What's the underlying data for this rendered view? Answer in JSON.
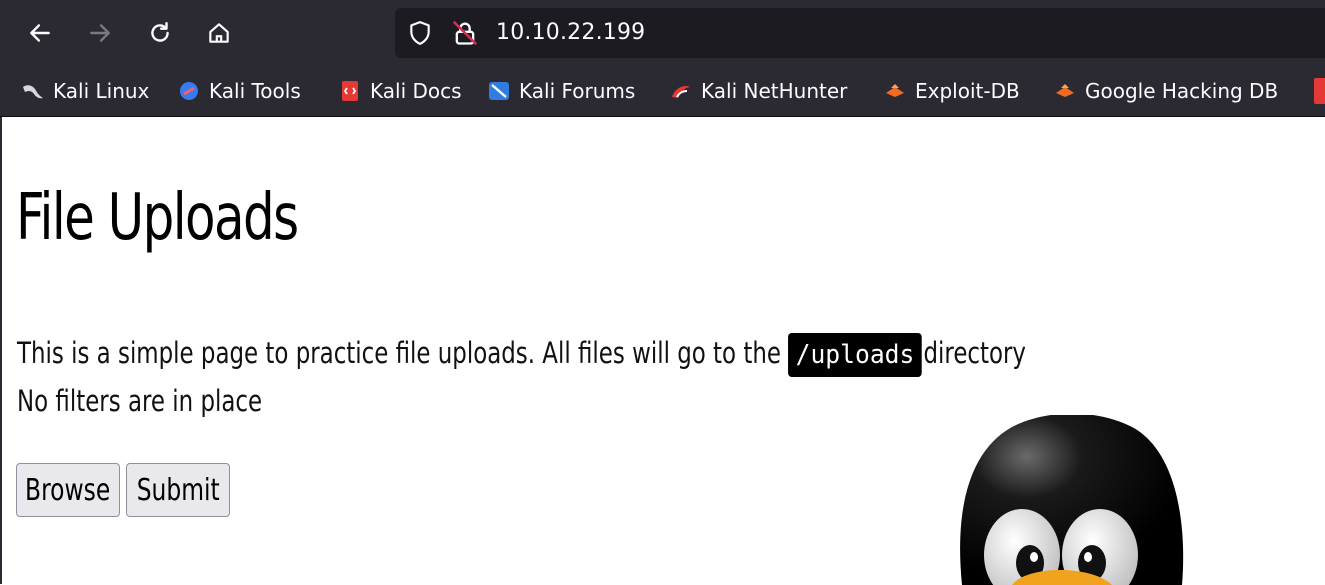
{
  "browser": {
    "nav": {
      "back_icon": "arrow-left-icon",
      "forward_icon": "arrow-right-icon",
      "reload_icon": "reload-icon",
      "home_icon": "home-icon"
    },
    "address_bar": {
      "url": "10.10.22.199",
      "shield_icon": "shield-icon",
      "insecure_lock_icon": "insecure-lock-icon"
    },
    "bookmarks": [
      {
        "label": "Kali Linux",
        "icon": "kali-dragon-icon"
      },
      {
        "label": "Kali Tools",
        "icon": "kali-tools-icon"
      },
      {
        "label": "Kali Docs",
        "icon": "kali-docs-icon"
      },
      {
        "label": "Kali Forums",
        "icon": "kali-forums-icon"
      },
      {
        "label": "Kali NetHunter",
        "icon": "kali-nethunter-icon"
      },
      {
        "label": "Exploit-DB",
        "icon": "exploit-db-icon"
      },
      {
        "label": "Google Hacking DB",
        "icon": "ghdb-icon"
      }
    ]
  },
  "page": {
    "title": "File Uploads",
    "description_before": "This is a simple page to practice file uploads. All files will go to the",
    "upload_path": "/uploads",
    "description_after": "directory",
    "note": "No filters are in place",
    "browse_label": "Browse",
    "submit_label": "Submit",
    "mascot": "tux-penguin-image"
  },
  "colors": {
    "chrome_bg": "#2b2a33",
    "urlbar_bg": "#1c1b22",
    "chrome_text": "#fbfbfe",
    "page_bg": "#ffffff",
    "button_bg": "#e9e9ed"
  }
}
